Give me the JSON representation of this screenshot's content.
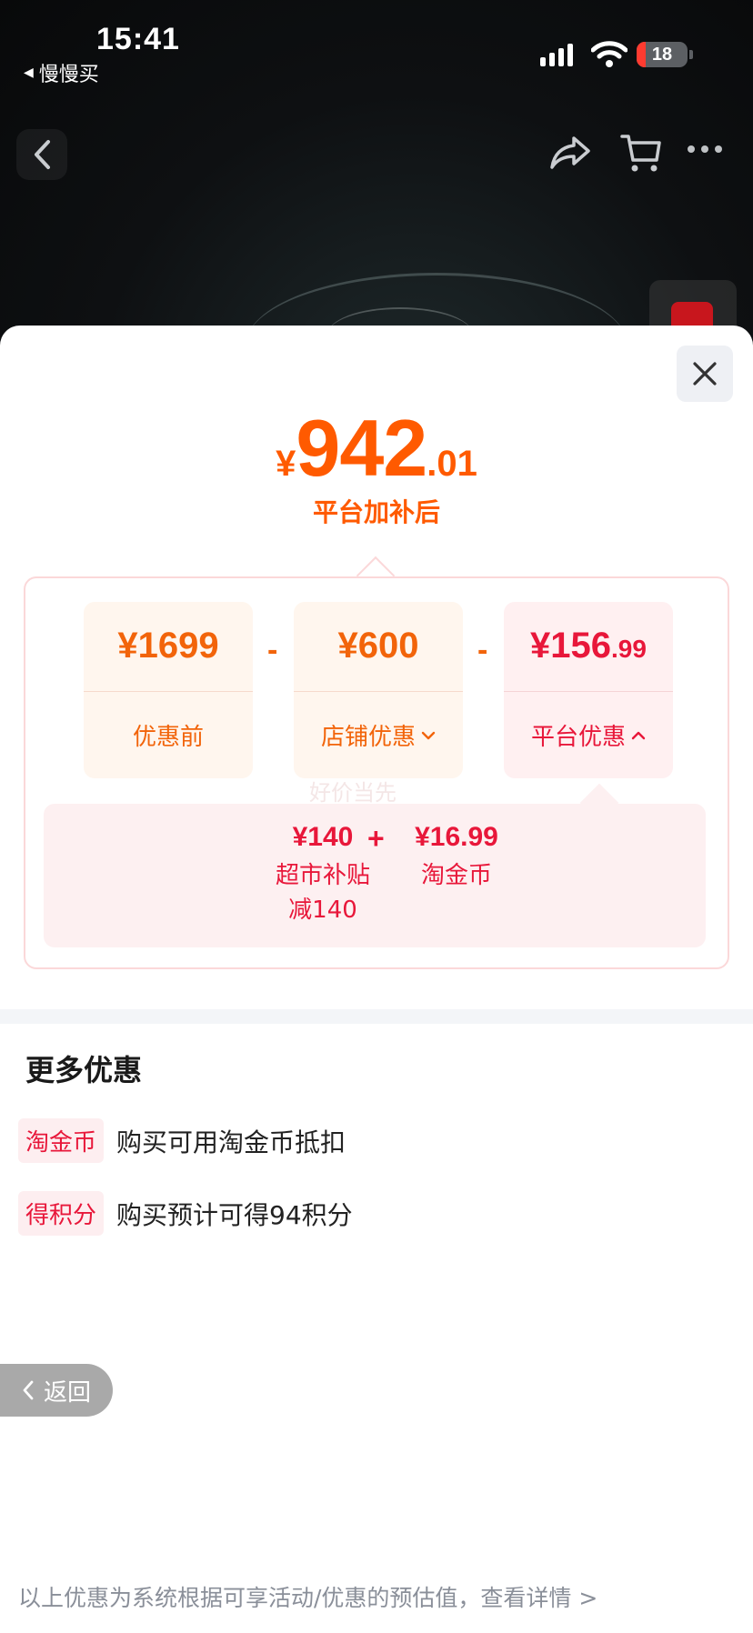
{
  "status_bar": {
    "time": "15:41",
    "back_app": "慢慢买",
    "battery": "18",
    "battery_level": 0.18,
    "icons": [
      "signal-icon",
      "wifi-icon",
      "battery-icon"
    ]
  },
  "nav": {
    "icons": [
      "back-icon",
      "share-icon",
      "cart-icon",
      "more-icon"
    ]
  },
  "price": {
    "currency": "¥",
    "integer": "942",
    "decimal": ".01",
    "label": "平台加补后"
  },
  "breakdown": {
    "watermark": "好价当先",
    "tiles": [
      {
        "value": "¥1699",
        "label": "优惠前"
      },
      {
        "value": "¥600",
        "label": "店铺优惠"
      },
      {
        "value": "¥156",
        "value_decimal": ".99",
        "label": "平台优惠"
      }
    ],
    "operator": "-",
    "platform_detail": {
      "plus": "+",
      "items": [
        {
          "value": "¥140",
          "label": "超市补贴",
          "note": "减140"
        },
        {
          "value": "¥16.99",
          "label": "淘金币"
        }
      ]
    }
  },
  "more": {
    "title": "更多优惠",
    "rows": [
      {
        "tag": "淘金币",
        "text": "购买可用淘金币抵扣"
      },
      {
        "tag": "得积分",
        "text": "购买预计可得94积分"
      }
    ]
  },
  "return_button": "返回",
  "footnote": "以上优惠为系统根据可享活动/优惠的预估值，查看详情 >",
  "colors": {
    "accent_orange": "#ff5a00",
    "accent_red": "#e8173a"
  }
}
